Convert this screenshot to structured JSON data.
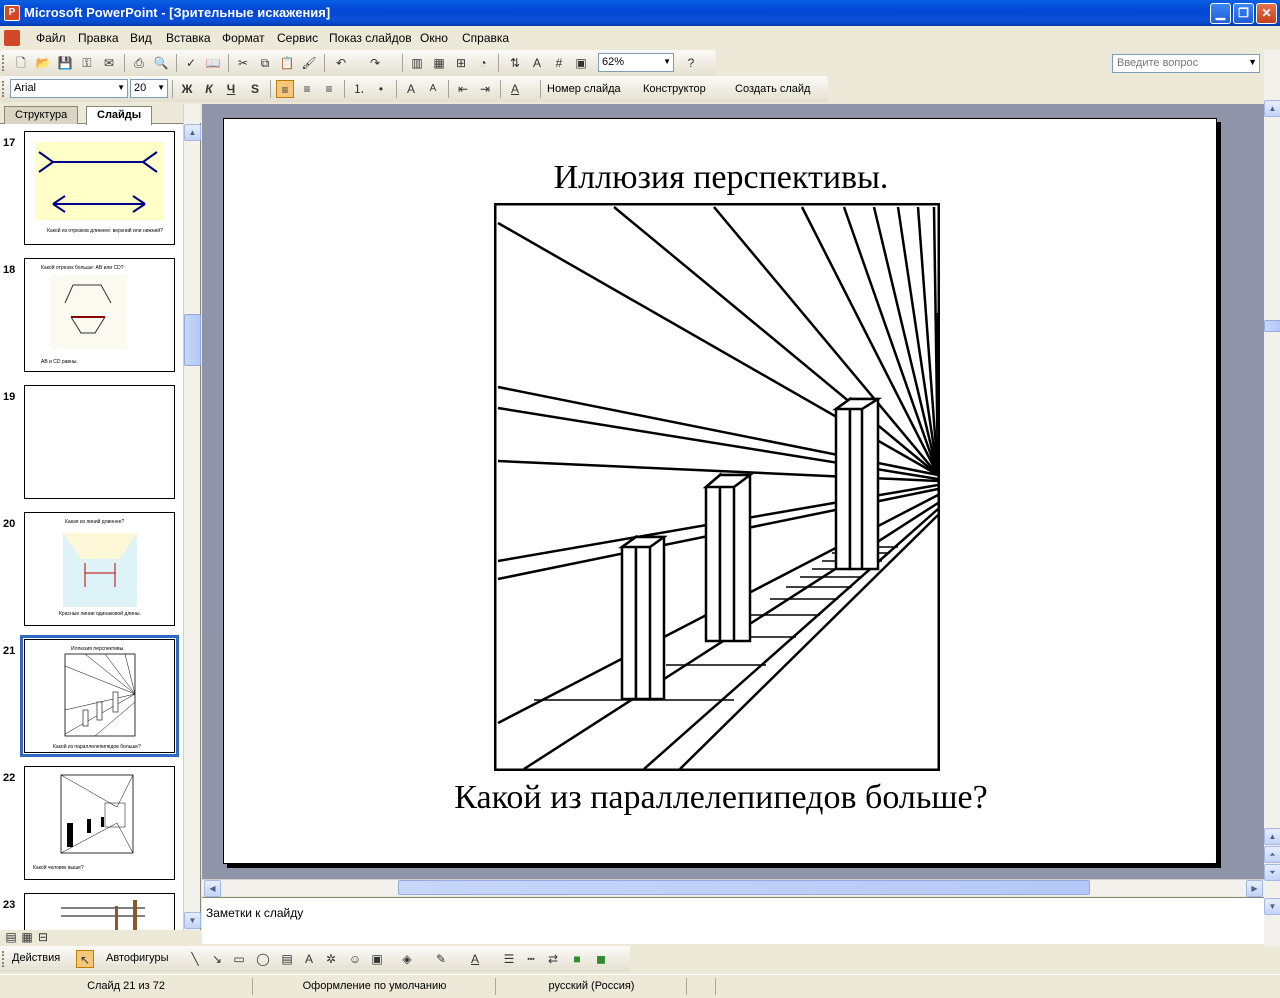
{
  "window": {
    "title": "Microsoft PowerPoint - [Зрительные искажения]"
  },
  "menu": {
    "items": [
      "Файл",
      "Правка",
      "Вид",
      "Вставка",
      "Формат",
      "Сервис",
      "Показ слайдов",
      "Окно",
      "Справка"
    ],
    "ask_placeholder": "Введите вопрос"
  },
  "standard_toolbar": {
    "zoom": "62%"
  },
  "formatting_toolbar": {
    "font": "Arial",
    "size": "20",
    "bold": "Ж",
    "italic": "К",
    "underline": "Ч",
    "shadow": "S",
    "slide_number": "Номер слайда",
    "designer": "Конструктор",
    "new_slide": "Создать слайд"
  },
  "panel": {
    "tabs": [
      "Структура",
      "Слайды"
    ],
    "active_tab": "Слайды",
    "slides": [
      {
        "num": "17",
        "caption": "Какой из отрезков длиннее: верхний или нижний?"
      },
      {
        "num": "18",
        "title": "Какой отрезок больше: AB или CD?",
        "caption": "AB и CD равны."
      },
      {
        "num": "19"
      },
      {
        "num": "20",
        "title": "Какая из линий длиннее?",
        "caption": "Красные линии одинаковой длины."
      },
      {
        "num": "21",
        "title": "Иллюзия перспективы.",
        "caption": "Какой из параллелепипедов больше?"
      },
      {
        "num": "22",
        "caption": "Какой человек выше?"
      },
      {
        "num": "23"
      }
    ]
  },
  "slide": {
    "title": "Иллюзия перспективы.",
    "caption": "Какой из параллелепипедов больше?"
  },
  "notes": {
    "placeholder": "Заметки к слайду"
  },
  "drawing_toolbar": {
    "actions": "Действия",
    "autoshapes": "Автофигуры"
  },
  "status": {
    "slide": "Слайд 21 из 72",
    "design": "Оформление по умолчанию",
    "language": "русский (Россия)"
  }
}
